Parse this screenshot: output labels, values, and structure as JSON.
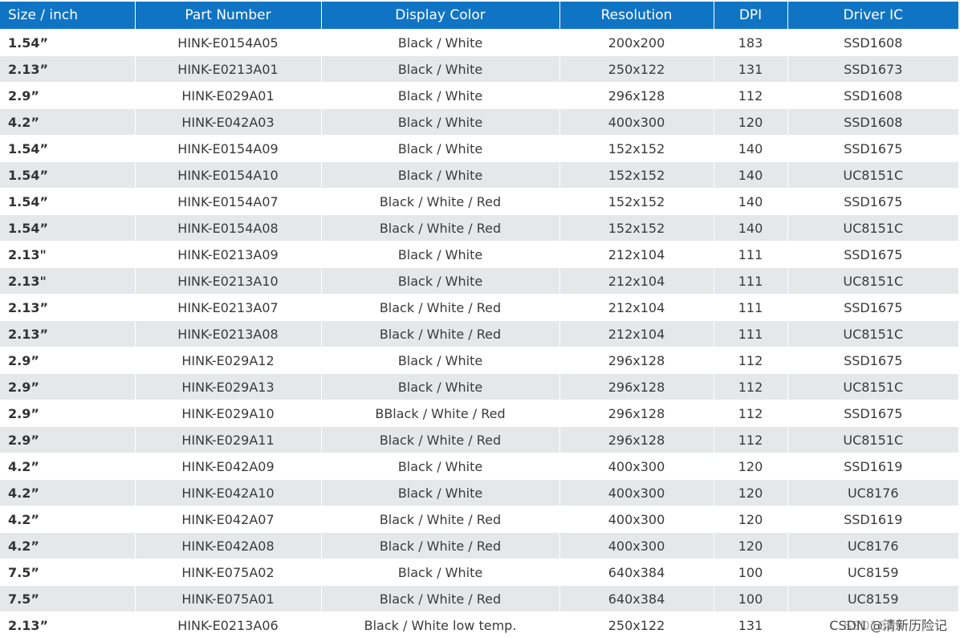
{
  "table": {
    "columns": [
      "Size / inch",
      "Part Number",
      "Display Color",
      "Resolution",
      "DPI",
      "Driver IC"
    ],
    "rows": [
      [
        "1.54”",
        "HINK-E0154A05",
        "Black / White",
        "200x200",
        "183",
        "SSD1608"
      ],
      [
        "2.13”",
        "HINK-E0213A01",
        "Black / White",
        "250x122",
        "131",
        "SSD1673"
      ],
      [
        "2.9”",
        "HINK-E029A01",
        "Black / White",
        "296x128",
        "112",
        "SSD1608"
      ],
      [
        "4.2”",
        "HINK-E042A03",
        "Black / White",
        "400x300",
        "120",
        "SSD1608"
      ],
      [
        "1.54”",
        "HINK-E0154A09",
        "Black / White",
        "152x152",
        "140",
        "SSD1675"
      ],
      [
        "1.54”",
        "HINK-E0154A10",
        "Black / White",
        "152x152",
        "140",
        "UC8151C"
      ],
      [
        "1.54”",
        "HINK-E0154A07",
        "Black / White / Red",
        "152x152",
        "140",
        "SSD1675"
      ],
      [
        "1.54”",
        "HINK-E0154A08",
        "Black / White / Red",
        "152x152",
        "140",
        "UC8151C"
      ],
      [
        "2.13\"",
        "HINK-E0213A09",
        "Black / White",
        "212x104",
        "111",
        "SSD1675"
      ],
      [
        "2.13\"",
        "HINK-E0213A10",
        "Black / White",
        "212x104",
        "111",
        "UC8151C"
      ],
      [
        "2.13”",
        "HINK-E0213A07",
        "Black / White / Red",
        "212x104",
        "111",
        "SSD1675"
      ],
      [
        "2.13”",
        "HINK-E0213A08",
        "Black / White / Red",
        "212x104",
        "111",
        "UC8151C"
      ],
      [
        "2.9”",
        "HINK-E029A12",
        "Black / White",
        "296x128",
        "112",
        "SSD1675"
      ],
      [
        "2.9”",
        "HINK-E029A13",
        "Black / White",
        "296x128",
        "112",
        "UC8151C"
      ],
      [
        "2.9”",
        "HINK-E029A10",
        "BBlack / White / Red",
        "296x128",
        "112",
        "SSD1675"
      ],
      [
        "2.9”",
        "HINK-E029A11",
        "Black / White / Red",
        "296x128",
        "112",
        "UC8151C"
      ],
      [
        "4.2”",
        "HINK-E042A09",
        "Black / White",
        "400x300",
        "120",
        "SSD1619"
      ],
      [
        "4.2”",
        "HINK-E042A10",
        "Black / White",
        "400x300",
        "120",
        "UC8176"
      ],
      [
        "4.2”",
        "HINK-E042A07",
        "Black / White / Red",
        "400x300",
        "120",
        "SSD1619"
      ],
      [
        "4.2”",
        "HINK-E042A08",
        "Black / White / Red",
        "400x300",
        "120",
        "UC8176"
      ],
      [
        "7.5”",
        "HINK-E075A02",
        "Black / White",
        "640x384",
        "100",
        "UC8159"
      ],
      [
        "7.5”",
        "HINK-E075A01",
        "Black / White / Red",
        "640x384",
        "100",
        "UC8159"
      ],
      [
        "2.13”",
        "HINK-E0213A06",
        "Black / White low temp.",
        "250x122",
        "131",
        "SSD1675"
      ]
    ]
  },
  "watermark": "CSDN @清新历险记",
  "colors": {
    "header_bg": "#1074c4",
    "header_text": "#ffffff",
    "stripe": "#e6e7e8"
  }
}
